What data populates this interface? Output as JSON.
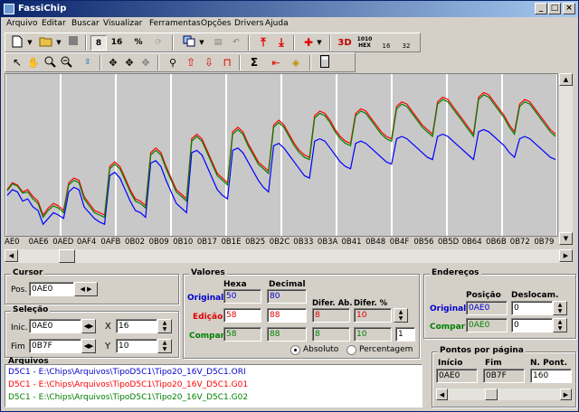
{
  "window": {
    "title": "FassiChip",
    "btn_min": "_",
    "btn_max": "□",
    "btn_close": "×"
  },
  "menu": [
    "Arquivo",
    "Editar",
    "Buscar",
    "Visualizar",
    "Ferramentas",
    "Opções",
    "Drivers",
    "Ajuda"
  ],
  "toolbar1": {
    "btn_8": "8",
    "btn_16": "16",
    "btn_percent": "%",
    "btn_3d": "3D",
    "btn_hex": "HEX",
    "btn_hex_top": "1010",
    "btn_16b": "16",
    "btn_32b": "32"
  },
  "toolbar2": {
    "sigma": "Σ"
  },
  "chart_data": {
    "type": "line",
    "x_labels": [
      "AE0",
      "0AE6",
      "0AED",
      "0AF4",
      "0AFB",
      "0B02",
      "0B09",
      "0B10",
      "0B17",
      "0B1E",
      "0B25",
      "0B2C",
      "0B33",
      "0B3A",
      "0B41",
      "0B48",
      "0B4F",
      "0B56",
      "0B5D",
      "0B64",
      "0B6B",
      "0B72",
      "0B79"
    ],
    "series": [
      {
        "color": "#0000ff",
        "values": [
          55,
          60,
          58,
          50,
          52,
          45,
          42,
          30,
          35,
          40,
          38,
          35,
          58,
          62,
          60,
          45,
          40,
          35,
          32,
          30,
          72,
          75,
          70,
          60,
          50,
          42,
          40,
          36,
          83,
          85,
          80,
          68,
          58,
          48,
          44,
          40,
          92,
          94,
          90,
          80,
          70,
          60,
          55,
          52,
          94,
          96,
          92,
          84,
          76,
          68,
          62,
          58,
          98,
          100,
          96,
          90,
          84,
          78,
          72,
          70,
          102,
          104,
          102,
          96,
          90,
          84,
          80,
          78,
          100,
          102,
          100,
          96,
          92,
          88,
          84,
          82,
          104,
          106,
          104,
          100,
          96,
          92,
          88,
          86,
          106,
          108,
          106,
          102,
          98,
          94,
          90,
          86,
          110,
          112,
          110,
          106,
          102,
          98,
          92,
          88,
          104,
          106,
          104,
          100,
          96,
          92,
          88,
          86
        ]
      },
      {
        "color": "#ff0000",
        "values": [
          60,
          66,
          64,
          58,
          60,
          54,
          50,
          38,
          44,
          48,
          46,
          42,
          66,
          70,
          68,
          54,
          48,
          42,
          40,
          38,
          80,
          84,
          80,
          70,
          60,
          52,
          50,
          46,
          92,
          96,
          92,
          80,
          70,
          60,
          56,
          52,
          104,
          108,
          104,
          94,
          84,
          74,
          70,
          66,
          110,
          114,
          110,
          100,
          92,
          84,
          80,
          76,
          116,
          120,
          116,
          108,
          100,
          94,
          90,
          88,
          124,
          128,
          126,
          120,
          112,
          106,
          102,
          100,
          126,
          130,
          128,
          122,
          116,
          110,
          106,
          104,
          132,
          136,
          134,
          128,
          122,
          116,
          112,
          108,
          136,
          140,
          138,
          132,
          126,
          120,
          114,
          108,
          140,
          144,
          142,
          136,
          130,
          124,
          116,
          110,
          134,
          138,
          136,
          130,
          124,
          118,
          112,
          108
        ]
      },
      {
        "color": "#008000",
        "values": [
          59,
          65,
          63,
          57,
          58,
          52,
          48,
          36,
          42,
          46,
          44,
          40,
          64,
          68,
          66,
          52,
          46,
          40,
          38,
          36,
          78,
          82,
          78,
          68,
          58,
          50,
          48,
          44,
          90,
          94,
          90,
          78,
          68,
          58,
          54,
          50,
          102,
          106,
          102,
          92,
          82,
          72,
          68,
          64,
          108,
          112,
          108,
          98,
          90,
          82,
          78,
          74,
          114,
          118,
          114,
          106,
          98,
          92,
          88,
          86,
          122,
          126,
          124,
          118,
          110,
          104,
          100,
          98,
          124,
          128,
          126,
          120,
          114,
          108,
          104,
          102,
          130,
          134,
          132,
          126,
          120,
          114,
          110,
          106,
          134,
          138,
          136,
          130,
          124,
          118,
          112,
          106,
          138,
          142,
          140,
          134,
          128,
          122,
          114,
          108,
          132,
          136,
          134,
          128,
          122,
          116,
          110,
          106
        ]
      }
    ],
    "ylim": [
      20,
      160
    ]
  },
  "cursor": {
    "title": "Cursor",
    "pos_label": "Pos.",
    "pos_value": "0AE0"
  },
  "selecao": {
    "title": "Seleção",
    "inic_label": "Inic.",
    "inic_value": "0AE0",
    "fim_label": "Fim",
    "fim_value": "0B7F",
    "x_label": "X",
    "x_value": "16",
    "y_label": "Y",
    "y_value": "10"
  },
  "valores": {
    "title": "Valores",
    "hexa_label": "Hexa",
    "decimal_label": "Decimal",
    "difer_ab_label": "Difer. Ab.",
    "difer_pct_label": "Difer. %",
    "original_label": "Original",
    "original_hex": "50",
    "original_dec": "80",
    "edicao_label": "Edição",
    "edicao_hex": "58",
    "edicao_dec": "88",
    "edicao_dif": "8",
    "edicao_pct": "10",
    "compar_label": "Compar",
    "compar_hex": "58",
    "compar_dec": "88",
    "compar_dif": "8",
    "compar_pct": "10",
    "step_value": "1",
    "absoluto_label": "Absoluto",
    "percentagem_label": "Percentagem"
  },
  "enderecos": {
    "title": "Endereços",
    "posicao_label": "Posição",
    "desloc_label": "Deslocam.",
    "original_label": "Original",
    "original_pos": "0AE0",
    "original_desloc": "0",
    "compar_label": "Compar",
    "compar_pos": "0AE0",
    "compar_desloc": "0"
  },
  "pontos": {
    "title": "Pontos por página",
    "inicio_label": "Início",
    "inicio_value": "0AE0",
    "fim_label": "Fim",
    "fim_value": "0B7F",
    "npont_label": "N. Pont.",
    "npont_value": "160"
  },
  "arquivos": {
    "title": "Arquivos",
    "files": [
      {
        "text": "D5C1 - E:\\Chips\\Arquivos\\TipoD5C1\\Tipo20_16V_D5C1.ORI",
        "color": "#0000cc"
      },
      {
        "text": "D5C1 - E:\\Chips\\Arquivos\\TipoD5C1\\Tipo20_16V_D5C1.G01",
        "color": "#ff0000"
      },
      {
        "text": "D5C1 - E:\\Chips\\Arquivos\\TipoD5C1\\Tipo20_16V_D5C1.G02",
        "color": "#008000"
      }
    ]
  }
}
